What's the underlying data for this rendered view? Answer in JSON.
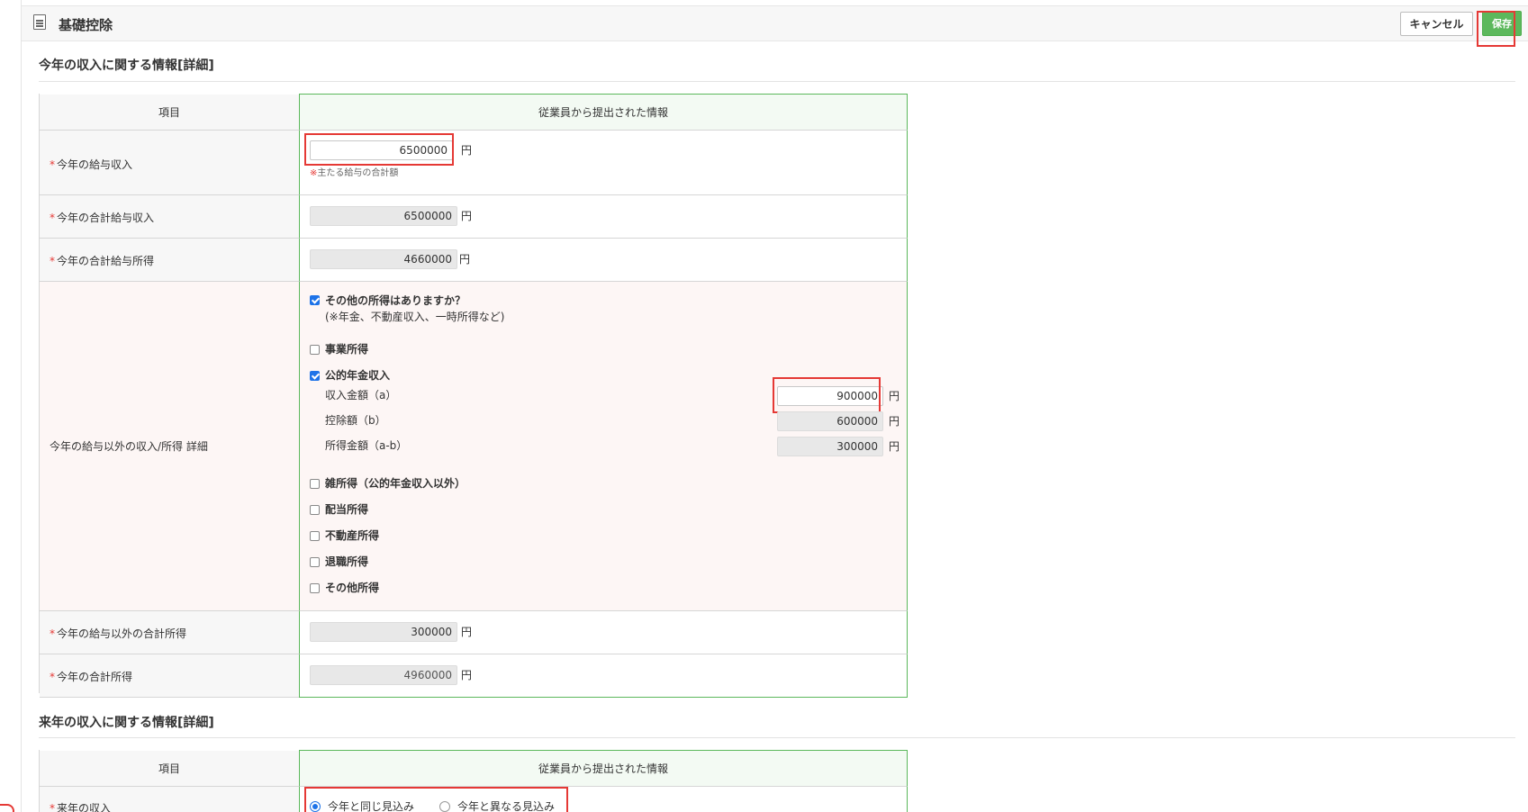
{
  "header": {
    "title": "基礎控除",
    "cancel_label": "キャンセル",
    "save_label": "保存"
  },
  "section1": {
    "title": "今年の収入に関する情報[詳細]",
    "col_item": "項目",
    "col_info": "従業員から提出された情報",
    "rows": {
      "salary_income": {
        "label": "今年の給与収入",
        "value": "6500000",
        "note_mark": "※",
        "note": "主たる給与の合計額"
      },
      "total_salary_income": {
        "label": "今年の合計給与収入",
        "value": "6500000"
      },
      "total_salary_earnings": {
        "label": "今年の合計給与所得",
        "value": "4660000"
      },
      "other_income": {
        "label": "今年の給与以外の収入/所得 詳細",
        "question": "その他の所得はありますか？",
        "question_note": "(※年金、不動産収入、一時所得など)",
        "business": "事業所得",
        "pension": "公的年金収入",
        "pension_income_label": "収入金額（a）",
        "pension_income_value": "900000",
        "pension_deduction_label": "控除額（b）",
        "pension_deduction_value": "600000",
        "pension_earnings_label": "所得金額（a-b）",
        "pension_earnings_value": "300000",
        "misc": "雑所得（公的年金収入以外）",
        "dividend": "配当所得",
        "real_estate": "不動産所得",
        "retirement": "退職所得",
        "other": "その他所得"
      },
      "other_total": {
        "label": "今年の給与以外の合計所得",
        "value": "300000"
      },
      "total_earnings": {
        "label": "今年の合計所得",
        "value": "4960000"
      }
    }
  },
  "section2": {
    "title": "来年の収入に関する情報[詳細]",
    "col_item": "項目",
    "col_info": "従業員から提出された情報",
    "next_year": {
      "label": "来年の収入",
      "option_same": "今年と同じ見込み",
      "option_diff": "今年と異なる見込み"
    }
  },
  "common": {
    "required_mark": "*",
    "yen": "円"
  },
  "state": {
    "has_other_income": true,
    "business_checked": false,
    "pension_checked": true,
    "misc_checked": false,
    "dividend_checked": false,
    "real_estate_checked": false,
    "retirement_checked": false,
    "other_checked": false,
    "next_year_selected": "same"
  },
  "colors": {
    "accent_green": "#5cb85c",
    "highlight_red": "#e53935",
    "check_blue": "#1e73e8"
  }
}
